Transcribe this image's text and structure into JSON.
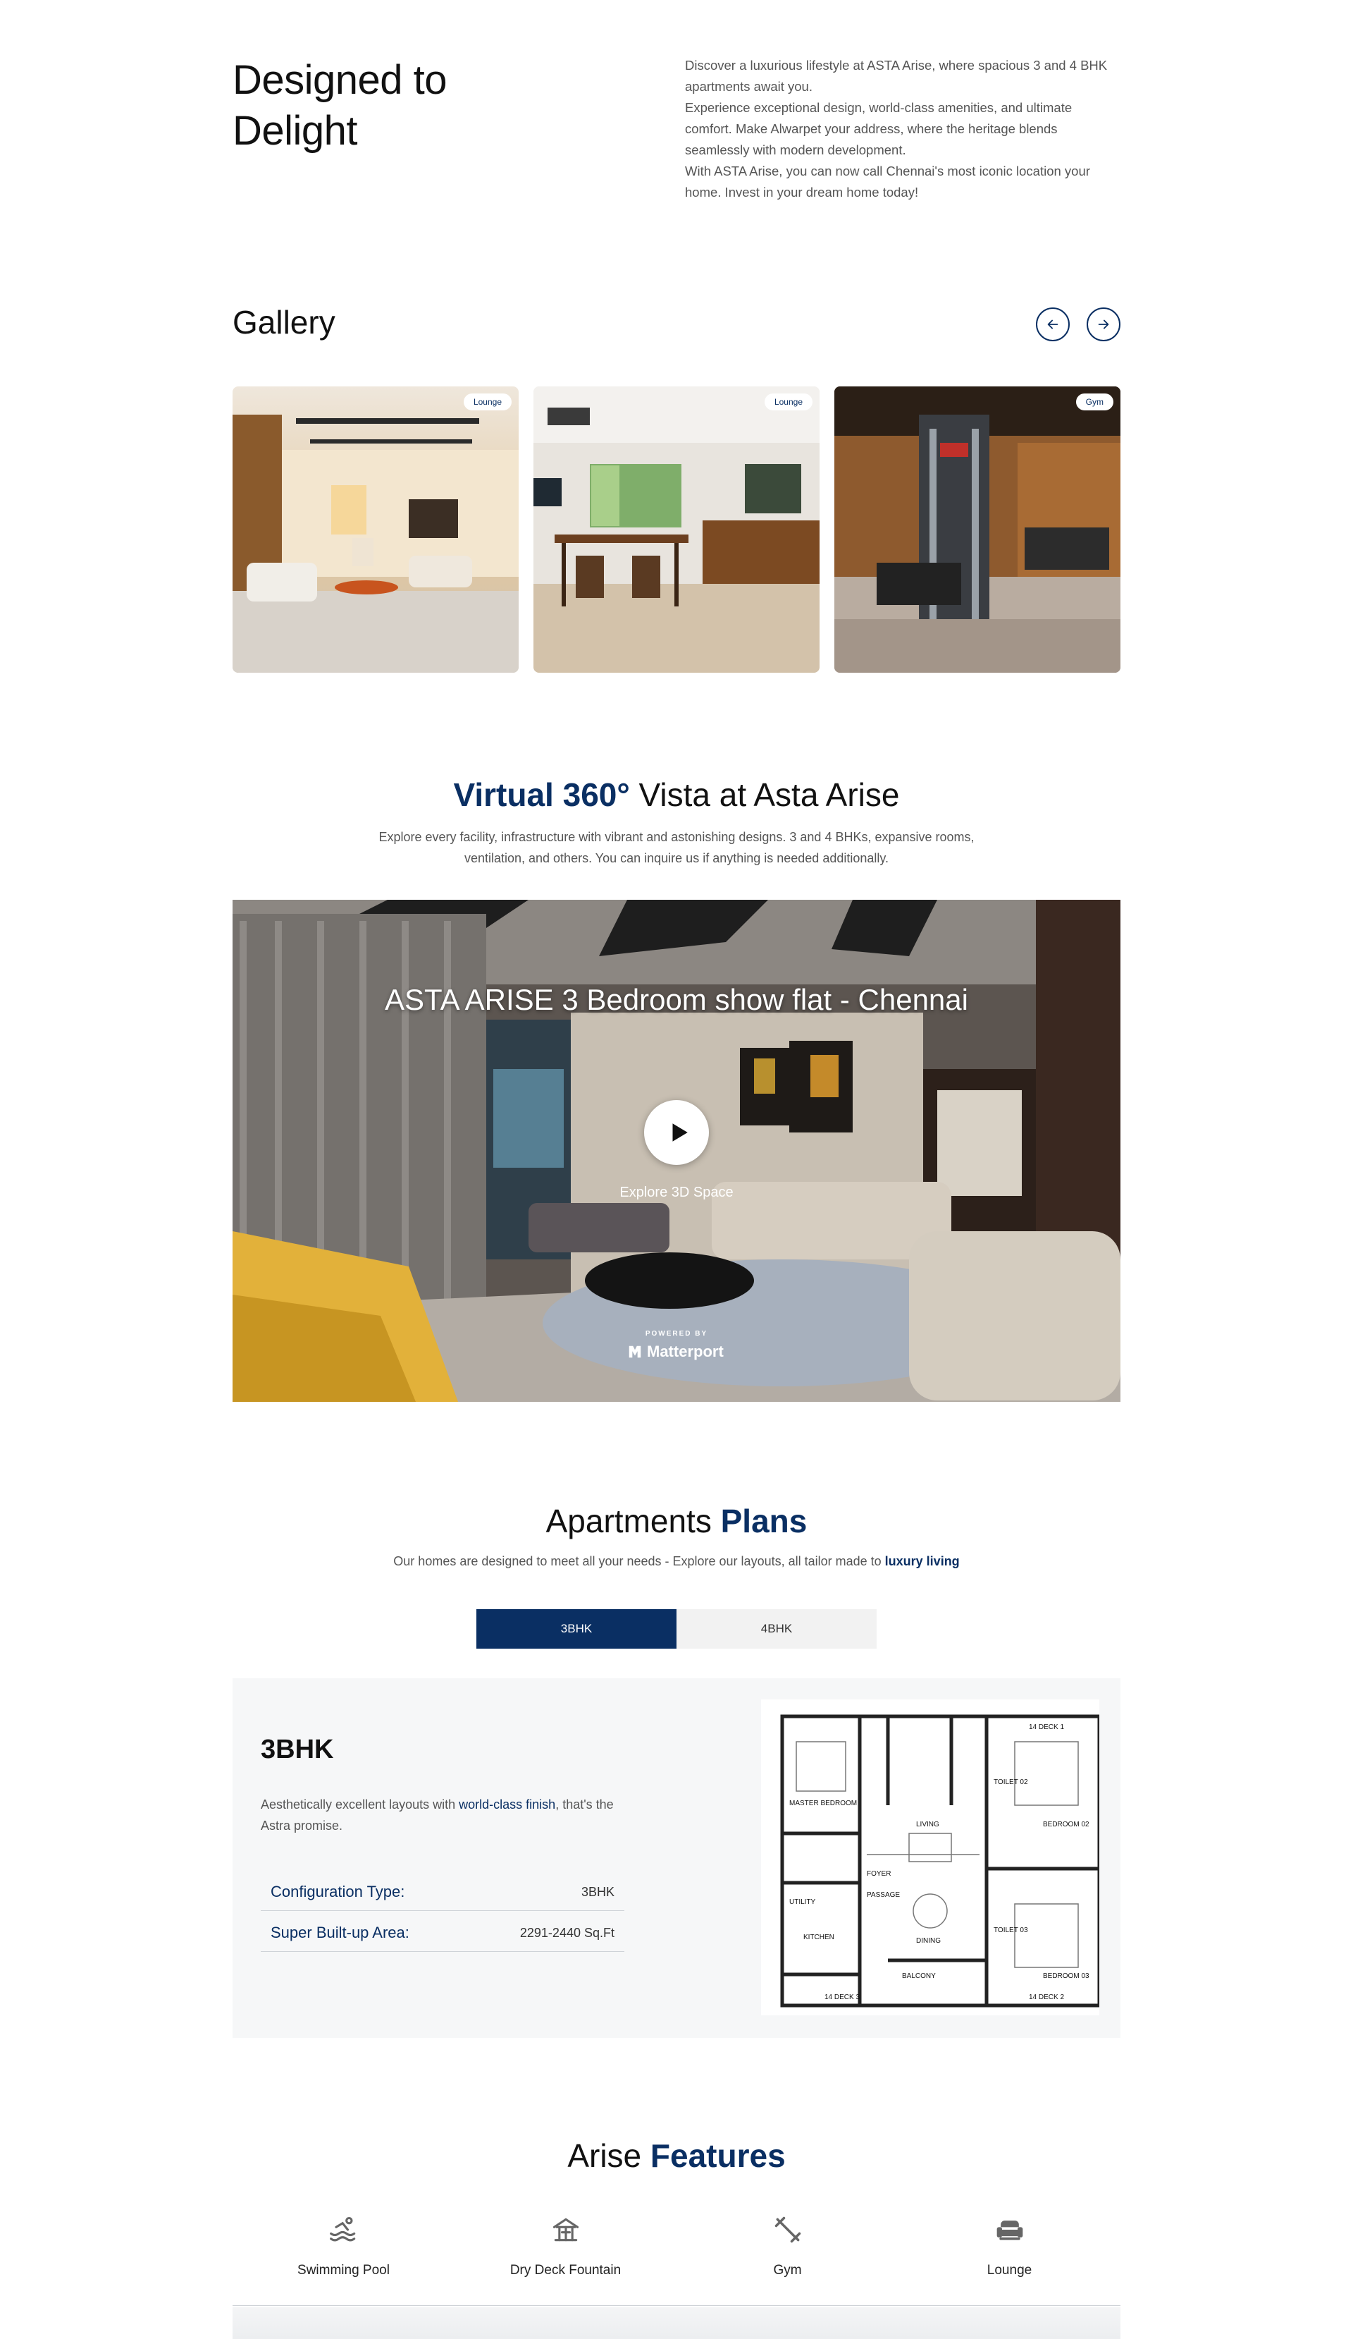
{
  "intro": {
    "title": "Designed to Delight",
    "paragraphs": [
      "Discover a luxurious lifestyle at ASTA Arise, where spacious 3 and 4 BHK apartments await you.",
      "Experience exceptional design, world-class amenities, and ultimate comfort. Make Alwarpet your address, where the heritage blends seamlessly with modern development.",
      "With ASTA Arise, you can now call Chennai's most iconic location your home. Invest in your dream home today!"
    ]
  },
  "gallery": {
    "title": "Gallery",
    "items": [
      {
        "tag": "Lounge",
        "icon": "lounge-photo"
      },
      {
        "tag": "Lounge",
        "icon": "lounge-bar-photo"
      },
      {
        "tag": "Gym",
        "icon": "gym-photo"
      }
    ]
  },
  "virtual": {
    "title_bold": "Virtual 360°",
    "title_rest": " Vista at Asta Arise",
    "description": "Explore every facility, infrastructure with vibrant and astonishing designs. 3 and 4 BHKs, expansive rooms, ventilation, and others. You can inquire us if anything is needed additionally.",
    "video_title": "ASTA ARISE 3 Bedroom show flat - Chennai",
    "explore_label": "Explore 3D Space",
    "powered_by": "POWERED BY",
    "brand": "Matterport"
  },
  "plans": {
    "title_rest": "Apartments ",
    "title_bold": "Plans",
    "subtitle": "Our homes are designed to meet all your needs - Explore our layouts, all tailor made to ",
    "subtitle_bold": "luxury living",
    "tabs": [
      "3BHK",
      "4BHK"
    ],
    "active_tab": "3BHK",
    "plan": {
      "name": "3BHK",
      "desc_pre": "Aesthetically excellent layouts with ",
      "desc_highlight": "world-class finish",
      "desc_post": ", that's the Astra promise.",
      "specs": [
        {
          "label": "Configuration Type:",
          "value": "3BHK"
        },
        {
          "label": "Super Built-up Area:",
          "value": "2291-2440 Sq.Ft"
        }
      ],
      "floorplan_labels": [
        "14 DECK 1",
        "14 DECK 2",
        "14 DECK 3",
        "MASTER BEDROOM",
        "BEDROOM 02",
        "BEDROOM 03",
        "KITCHEN",
        "LIVING",
        "DINING",
        "BALCONY",
        "FOYER",
        "PASSAGE",
        "TOILET 02",
        "TOILET 03",
        "UTILITY"
      ]
    }
  },
  "features": {
    "title_rest": "Arise ",
    "title_bold": "Features",
    "items": [
      {
        "label": "Swimming Pool",
        "icon": "swimming-pool-icon"
      },
      {
        "label": "Dry Deck Fountain",
        "icon": "fountain-icon"
      },
      {
        "label": "Gym",
        "icon": "dumbbell-icon"
      },
      {
        "label": "Lounge",
        "icon": "sofa-icon"
      }
    ]
  },
  "colors": {
    "accent": "#0a2f63",
    "muted": "#555555",
    "panel": "#f6f7f8"
  }
}
